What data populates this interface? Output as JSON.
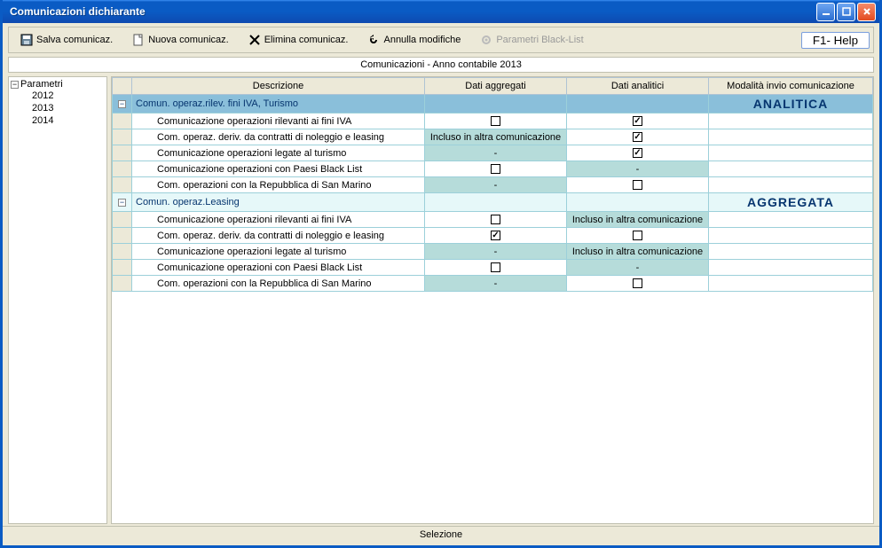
{
  "titlebar": {
    "title": "Comunicazioni dichiarante"
  },
  "toolbar": {
    "save": "Salva comunicaz.",
    "new": "Nuova comunicaz.",
    "delete": "Elimina comunicaz.",
    "undo": "Annulla modifiche",
    "blacklist": "Parametri Black-List",
    "help": "F1- Help"
  },
  "subtitle": "Comunicazioni - Anno contabile 2013",
  "tree": {
    "root": "Parametri",
    "items": [
      "2012",
      "2013",
      "2014"
    ]
  },
  "columns": {
    "desc": "Descrizione",
    "agg": "Dati aggregati",
    "ana": "Dati analitici",
    "mod": "Modalità invio comunicazione"
  },
  "labels": {
    "included": "Incluso in altra comunicazione",
    "dash": "-",
    "analitica": "ANALITICA",
    "aggregata": "AGGREGATA"
  },
  "groups": [
    {
      "title": "Comun. operaz.rilev. fini IVA, Turismo",
      "mode_key": "analitica",
      "mode_class": "modlabel1",
      "rows": [
        {
          "desc": "Comunicazione operazioni rilevanti ai fini IVA",
          "agg": "unchecked",
          "ana": "checked"
        },
        {
          "desc": "Com. operaz. deriv. da contratti di noleggio e leasing",
          "agg": "included",
          "ana": "checked"
        },
        {
          "desc": "Comunicazione operazioni legate al turismo",
          "agg": "dash",
          "ana": "checked"
        },
        {
          "desc": "Comunicazione operazioni con Paesi Black List",
          "agg": "unchecked",
          "ana": "dash"
        },
        {
          "desc": "Com. operazioni con la Repubblica di San Marino",
          "agg": "dash",
          "ana": "unchecked"
        }
      ]
    },
    {
      "title": "Comun. operaz.Leasing",
      "mode_key": "aggregata",
      "mode_class": "modlabel2",
      "rows": [
        {
          "desc": "Comunicazione operazioni rilevanti ai fini IVA",
          "agg": "unchecked",
          "ana": "included"
        },
        {
          "desc": "Com. operaz. deriv. da contratti di noleggio e leasing",
          "agg": "checked",
          "ana": "unchecked"
        },
        {
          "desc": "Comunicazione operazioni legate al turismo",
          "agg": "dash",
          "ana": "included"
        },
        {
          "desc": "Comunicazione operazioni con Paesi Black List",
          "agg": "unchecked",
          "ana": "dash"
        },
        {
          "desc": "Com. operazioni con la Repubblica di San Marino",
          "agg": "dash",
          "ana": "unchecked"
        }
      ]
    }
  ],
  "status": "Selezione"
}
